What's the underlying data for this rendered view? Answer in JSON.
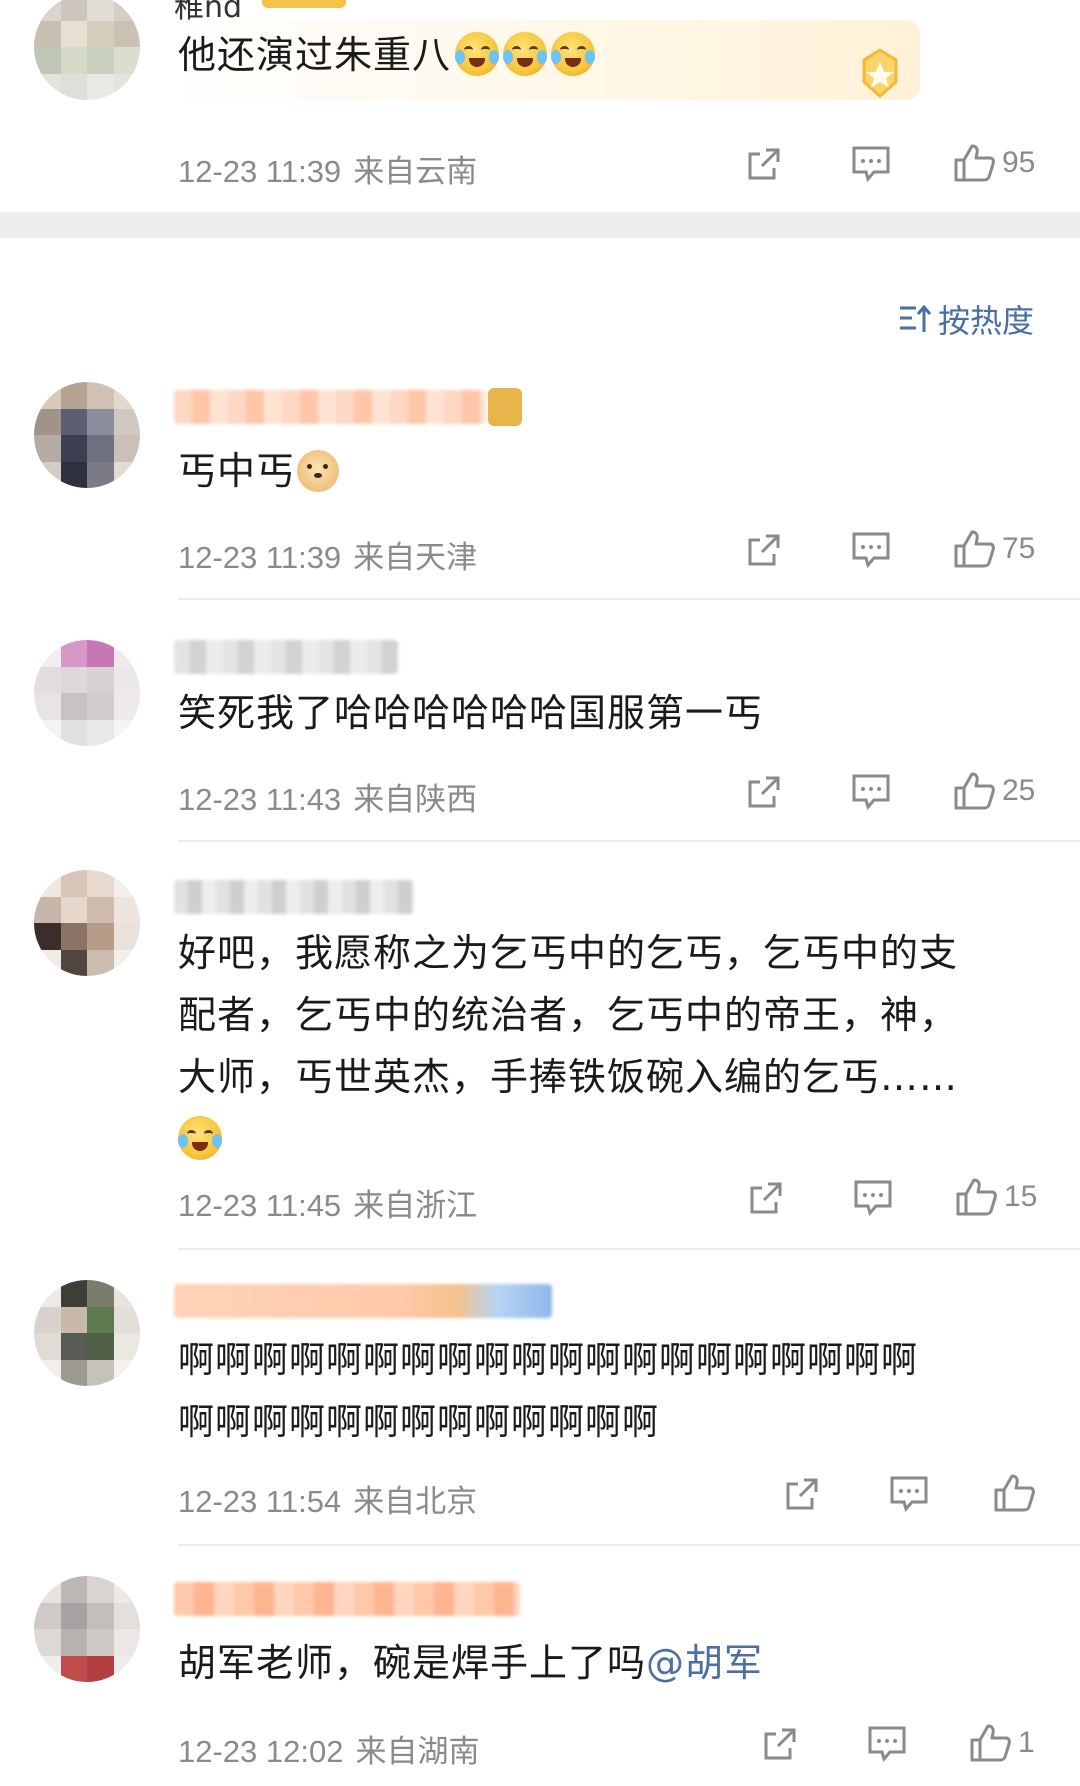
{
  "top_comment": {
    "name_fragment": "稚nd",
    "text": "他还演过朱重八",
    "time": "12-23 11:39",
    "location": "来自云南",
    "likes": "95"
  },
  "sort": {
    "icon": "sort-icon",
    "label": "按热度"
  },
  "comments": [
    {
      "text": "丐中丐",
      "time": "12-23 11:39",
      "location": "来自天津",
      "likes": "75"
    },
    {
      "text": "笑死我了哈哈哈哈哈哈国服第一丐",
      "time": "12-23 11:43",
      "location": "来自陕西",
      "likes": "25"
    },
    {
      "text_line1": "好吧，我愿称之为乞丐中的乞丐，乞丐中的支",
      "text_line2": "配者，乞丐中的统治者，乞丐中的帝王，神，",
      "text_line3": "大师，丐世英杰，手捧铁饭碗入编的乞丐……",
      "time": "12-23 11:45",
      "location": "来自浙江",
      "likes": "15"
    },
    {
      "text_line1": "啊啊啊啊啊啊啊啊啊啊啊啊啊啊啊啊啊啊啊啊",
      "text_line2": "啊啊啊啊啊啊啊啊啊啊啊啊啊",
      "time": "12-23 11:54",
      "location": "来自北京",
      "likes": ""
    },
    {
      "text": "胡军老师，碗是焊手上了吗",
      "mention": "@胡军",
      "time": "12-23 12:02",
      "location": "来自湖南",
      "likes": "1"
    }
  ],
  "icons": {
    "share": "share-icon",
    "comment": "comment-icon",
    "like": "thumbs-up-icon"
  },
  "colors": {
    "meta_gray": "#8a8a8a",
    "link_blue": "#4a6fa5",
    "separator": "#eeeeee"
  }
}
